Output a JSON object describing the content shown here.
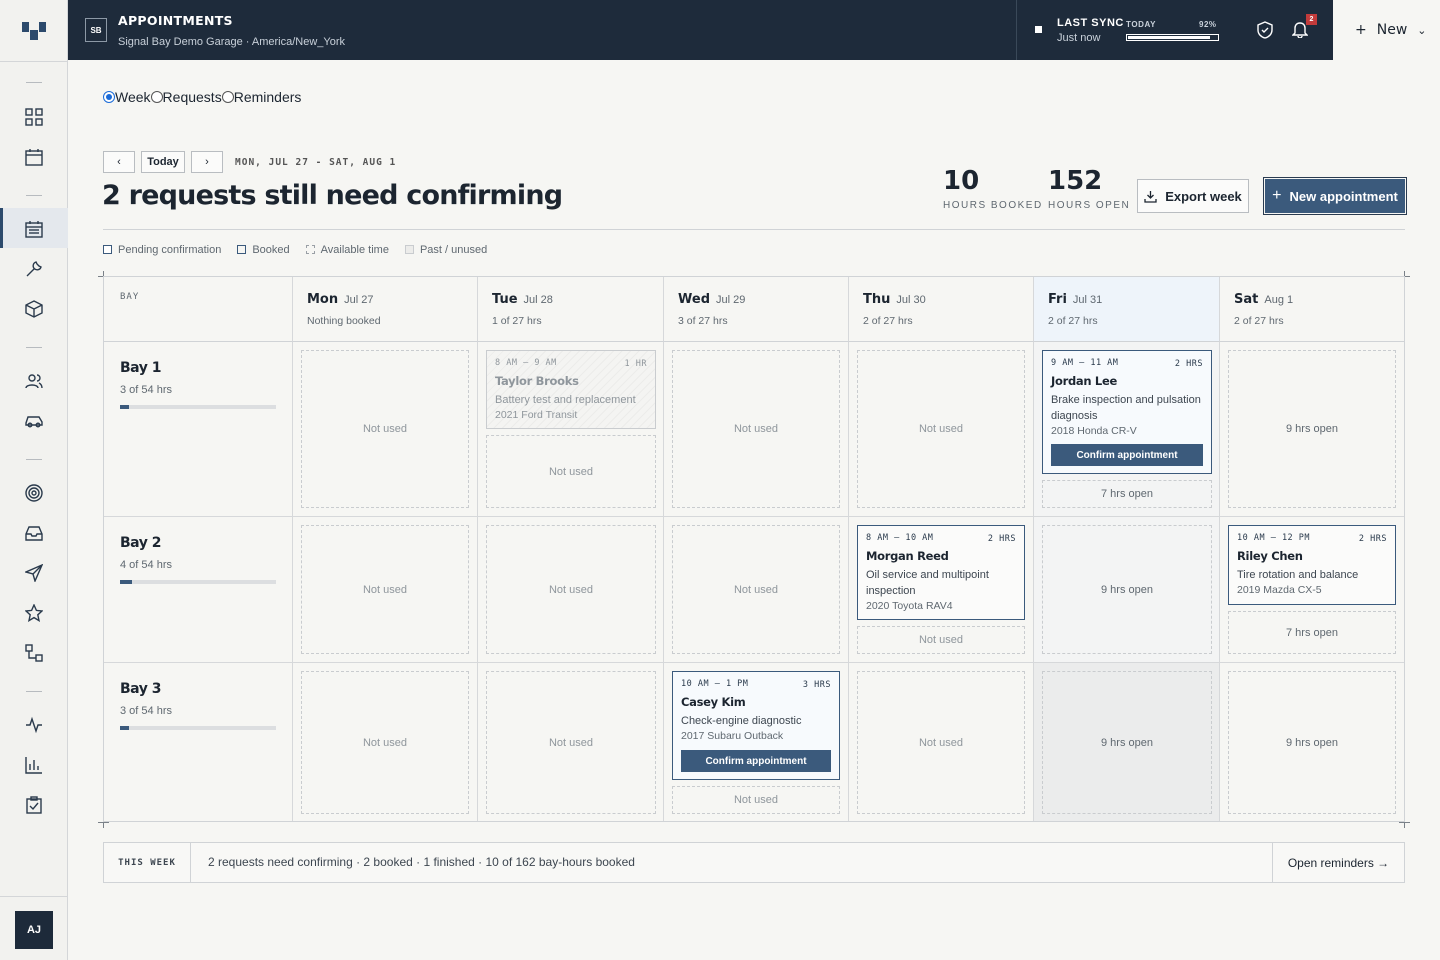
{
  "header": {
    "org_initials": "SB",
    "title": "APPOINTMENTS",
    "subtitle": "Signal Bay Demo Garage · America/New_York",
    "sync_label": "LAST SYNC",
    "sync_value": "Just now",
    "today_label": "TODAY",
    "today_percent_label": "92%",
    "today_progress": 0.92,
    "notification_count": "2",
    "new_label": "New"
  },
  "user": {
    "initials": "AJ"
  },
  "views": {
    "options": [
      "Week",
      "Requests",
      "Reminders"
    ],
    "selected": "Week"
  },
  "toolbar": {
    "prev_label": "‹",
    "today_label": "Today",
    "next_label": "›",
    "range": "MON, JUL 27 - SAT, AUG 1",
    "headline": "2 requests still need confirming",
    "stats": [
      {
        "value": "10",
        "label": "HOURS BOOKED"
      },
      {
        "value": "152",
        "label": "HOURS OPEN"
      }
    ],
    "export_label": "Export week",
    "new_appointment_label": "New appointment"
  },
  "legend": [
    "Pending confirmation",
    "Booked",
    "Available time",
    "Past / unused"
  ],
  "grid": {
    "corner_label": "BAY",
    "days": [
      {
        "day": "Mon",
        "date": "Jul 27",
        "meta": "Nothing booked"
      },
      {
        "day": "Tue",
        "date": "Jul 28",
        "meta": "1 of 27 hrs"
      },
      {
        "day": "Wed",
        "date": "Jul 29",
        "meta": "3 of 27 hrs"
      },
      {
        "day": "Thu",
        "date": "Jul 30",
        "meta": "2 of 27 hrs"
      },
      {
        "day": "Fri",
        "date": "Jul 31",
        "meta": "2 of 27 hrs",
        "today": true
      },
      {
        "day": "Sat",
        "date": "Aug 1",
        "meta": "2 of 27 hrs"
      }
    ],
    "bays": [
      {
        "name": "Bay 1",
        "hours": "3 of 54 hrs",
        "fill": 0.0556
      },
      {
        "name": "Bay 2",
        "hours": "4 of 54 hrs",
        "fill": 0.0741
      },
      {
        "name": "Bay 3",
        "hours": "3 of 54 hrs",
        "fill": 0.0556
      }
    ],
    "not_used": "Not used",
    "open_9": "9 hrs open",
    "open_7": "7 hrs open",
    "appointments": {
      "taylor": {
        "time": "8 AM – 9 AM",
        "duration": "1 HR",
        "name": "Taylor Brooks",
        "service": "Battery test and replacement",
        "vehicle": "2021 Ford Transit"
      },
      "jordan": {
        "time": "9 AM – 11 AM",
        "duration": "2 HRS",
        "name": "Jordan Lee",
        "service": "Brake inspection and pulsation diagnosis",
        "vehicle": "2018 Honda CR-V",
        "action": "Confirm appointment"
      },
      "morgan": {
        "time": "8 AM – 10 AM",
        "duration": "2 HRS",
        "name": "Morgan Reed",
        "service": "Oil service and multipoint inspection",
        "vehicle": "2020 Toyota RAV4"
      },
      "riley": {
        "time": "10 AM – 12 PM",
        "duration": "2 HRS",
        "name": "Riley Chen",
        "service": "Tire rotation and balance",
        "vehicle": "2019 Mazda CX-5"
      },
      "casey": {
        "time": "10 AM – 1 PM",
        "duration": "3 HRS",
        "name": "Casey Kim",
        "service": "Check-engine diagnostic",
        "vehicle": "2017 Subaru Outback",
        "action": "Confirm appointment"
      }
    }
  },
  "summary": {
    "label": "THIS WEEK",
    "text": "2 requests need confirming · 2 booked · 1 finished · 10 of 162 bay-hours booked",
    "link": "Open reminders →"
  },
  "colors": {
    "navy": "#1e2b3b",
    "accent": "#3b5a7c",
    "today_column": "#eef4fa",
    "badge": "#c33b3b"
  }
}
